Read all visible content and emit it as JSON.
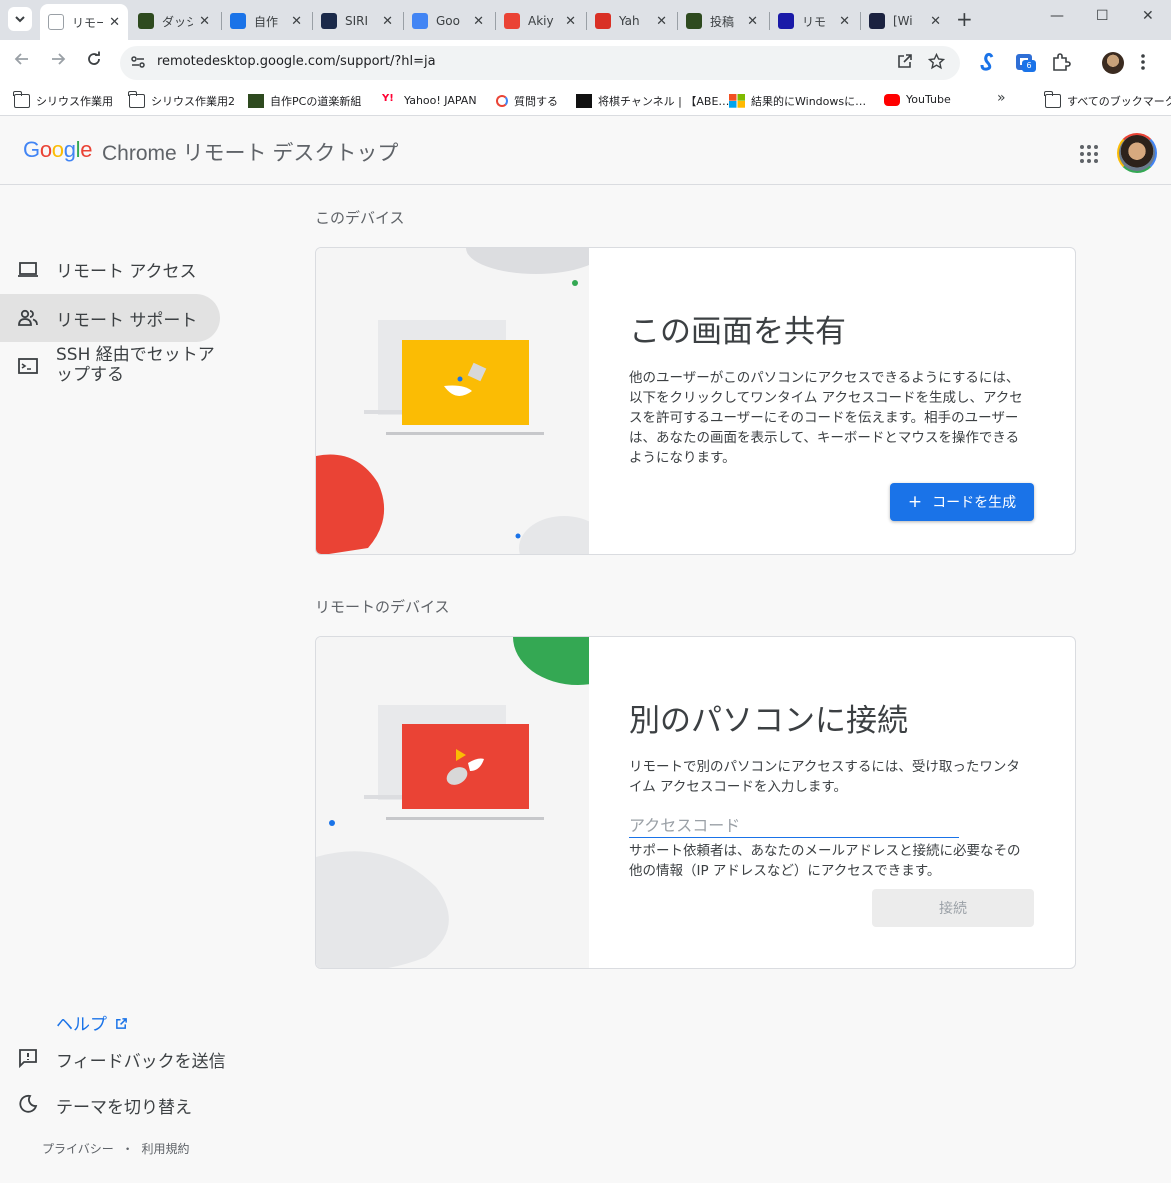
{
  "browser": {
    "tabs": [
      {
        "label": "リモー",
        "favicon_color": "#ffffff",
        "active": true
      },
      {
        "label": "ダッシ",
        "favicon_color": "#2e4a1f",
        "active": false
      },
      {
        "label": "自作",
        "favicon_color": "#1a73e8",
        "active": false
      },
      {
        "label": "SIRI",
        "favicon_color": "#1b2a4a",
        "active": false
      },
      {
        "label": "Goo",
        "favicon_color": "#4285f4",
        "active": false
      },
      {
        "label": "Akiy",
        "favicon_color": "#ea4335",
        "active": false
      },
      {
        "label": "Yah",
        "favicon_color": "#d93025",
        "active": false
      },
      {
        "label": "投稿",
        "favicon_color": "#2e4a1f",
        "active": false
      },
      {
        "label": "リモ",
        "favicon_color": "#1a1aa8",
        "active": false
      },
      {
        "label": "[Wi",
        "favicon_color": "#1b2240",
        "active": false
      }
    ],
    "new_tab_label": "+",
    "window_controls": {
      "minimize": "—",
      "maximize": "☐",
      "close": "✕"
    },
    "address": "remotedesktop.google.com/support/?hl=ja",
    "extension_badge": "6",
    "bookmarks": [
      {
        "label": "シリウス作業用",
        "icon": "folder-icon"
      },
      {
        "label": "シリウス作業用2",
        "icon": "folder-icon"
      },
      {
        "label": "自作PCの道楽新組",
        "icon": "game-icon"
      },
      {
        "label": "Yahoo! JAPAN",
        "icon": "yahoo-icon"
      },
      {
        "label": "質問する",
        "icon": "question-icon"
      },
      {
        "label": "将棋チャンネル | 【ABE…",
        "icon": "shogi-icon"
      },
      {
        "label": "結果的にWindowsに…",
        "icon": "windows-icon"
      },
      {
        "label": "YouTube",
        "icon": "youtube-icon"
      }
    ],
    "bookmarks_more": "»",
    "all_bookmarks": "すべてのブックマーク"
  },
  "header": {
    "logo": [
      "G",
      "o",
      "o",
      "g",
      "l",
      "e"
    ],
    "product": "Chrome リモート デスクトップ"
  },
  "sidebar": {
    "items": [
      {
        "label": "リモート アクセス",
        "icon": "laptop-icon",
        "active": false
      },
      {
        "label": "リモート サポート",
        "icon": "people-icon",
        "active": true
      },
      {
        "label_line1": "SSH 経由でセットア",
        "label_line2": "ップする",
        "icon": "terminal-icon",
        "active": false
      }
    ],
    "help": "ヘルプ",
    "feedback": "フィードバックを送信",
    "theme": "テーマを切り替え",
    "privacy": "プライバシー",
    "separator": "・",
    "terms": "利用規約"
  },
  "this_device": {
    "section_title": "このデバイス",
    "title": "この画面を共有",
    "description": "他のユーザーがこのパソコンにアクセスできるようにするには、以下をクリックしてワンタイム アクセスコードを生成し、アクセスを許可するユーザーにそのコードを伝えます。相手のユーザーは、あなたの画面を表示して、キーボードとマウスを操作できるようになります。",
    "button": "コードを生成",
    "button_icon": "+",
    "accent": "#1a73e8",
    "screen_color": "#fbbc04"
  },
  "remote_device": {
    "section_title": "リモートのデバイス",
    "title": "別のパソコンに接続",
    "description": "リモートで別のパソコンにアクセスするには、受け取ったワンタイム アクセスコードを入力します。",
    "input_placeholder": "アクセスコード",
    "input_value": "",
    "note": "サポート依頼者は、あなたのメールアドレスと接続に必要なその他の情報（IP アドレスなど）にアクセスできます。",
    "button": "接続",
    "screen_color": "#ea4335"
  }
}
